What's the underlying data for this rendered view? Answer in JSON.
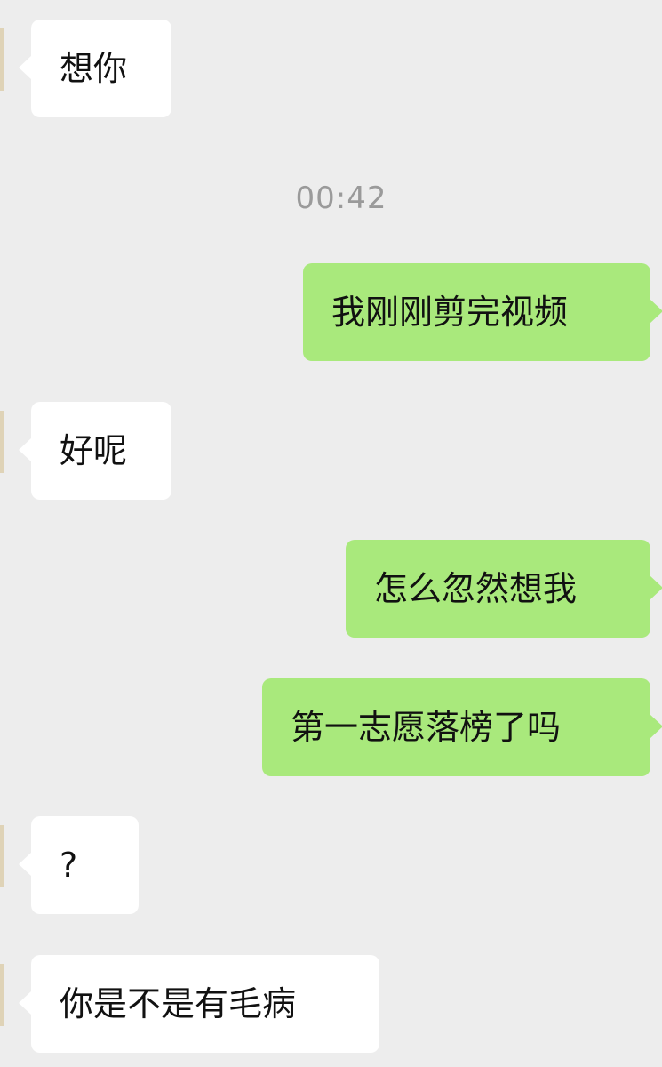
{
  "chat": {
    "timestamp": "00:42",
    "messages": [
      {
        "side": "in",
        "text": "想你"
      },
      {
        "side": "out",
        "text": "我刚刚剪完视频"
      },
      {
        "side": "in",
        "text": "好呢"
      },
      {
        "side": "out",
        "text": "怎么忽然想我"
      },
      {
        "side": "out",
        "text": "第一志愿落榜了吗"
      },
      {
        "side": "in",
        "text": "?"
      },
      {
        "side": "in",
        "text": "你是不是有毛病"
      }
    ]
  },
  "colors": {
    "background": "#ededed",
    "incoming_bubble": "#ffffff",
    "outgoing_bubble": "#a9e97c",
    "timestamp_text": "#9a9a9a"
  }
}
